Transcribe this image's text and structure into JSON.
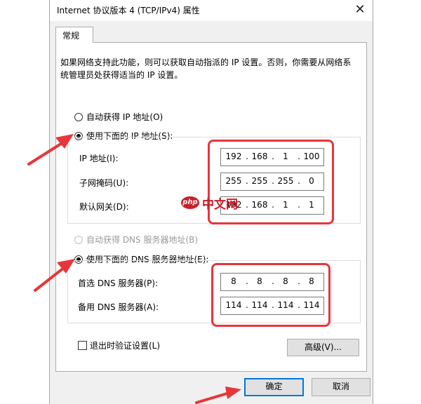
{
  "window": {
    "title": "Internet 协议版本 4 (TCP/IPv4) 属性",
    "close_glyph": "✕"
  },
  "tab": {
    "label": "常规"
  },
  "description": "如果网络支持此功能，则可以获取自动指派的 IP 设置。否则，你需要从网络系统管理员处获得适当的 IP 设置。",
  "ip_section": {
    "auto_label": "自动获得 IP 地址(O)",
    "manual_label": "使用下面的 IP 地址(S):",
    "ip_label": "IP 地址(I):",
    "ip_value": [
      "192",
      "168",
      "1",
      "100"
    ],
    "subnet_label": "子网掩码(U):",
    "subnet_value": [
      "255",
      "255",
      "255",
      "0"
    ],
    "gateway_label": "默认网关(D):",
    "gateway_value": [
      "192",
      "168",
      "1",
      "1"
    ]
  },
  "dns_section": {
    "auto_label": "自动获得 DNS 服务器地址(B)",
    "manual_label": "使用下面的 DNS 服务器地址(E):",
    "preferred_label": "首选 DNS 服务器(P):",
    "preferred_value": [
      "8",
      "8",
      "8",
      "8"
    ],
    "alternate_label": "备用 DNS 服务器(A):",
    "alternate_value": [
      "114",
      "114",
      "114",
      "114"
    ]
  },
  "validate_label": "退出时验证设置(L)",
  "advanced_label": "高级(V)...",
  "ok_label": "确定",
  "cancel_label": "取消",
  "watermark": {
    "text": "中文网",
    "logo": "php"
  },
  "colors": {
    "annotation": "#e8353a",
    "watermark": "#c81f2a",
    "focus": "#0078d7"
  }
}
